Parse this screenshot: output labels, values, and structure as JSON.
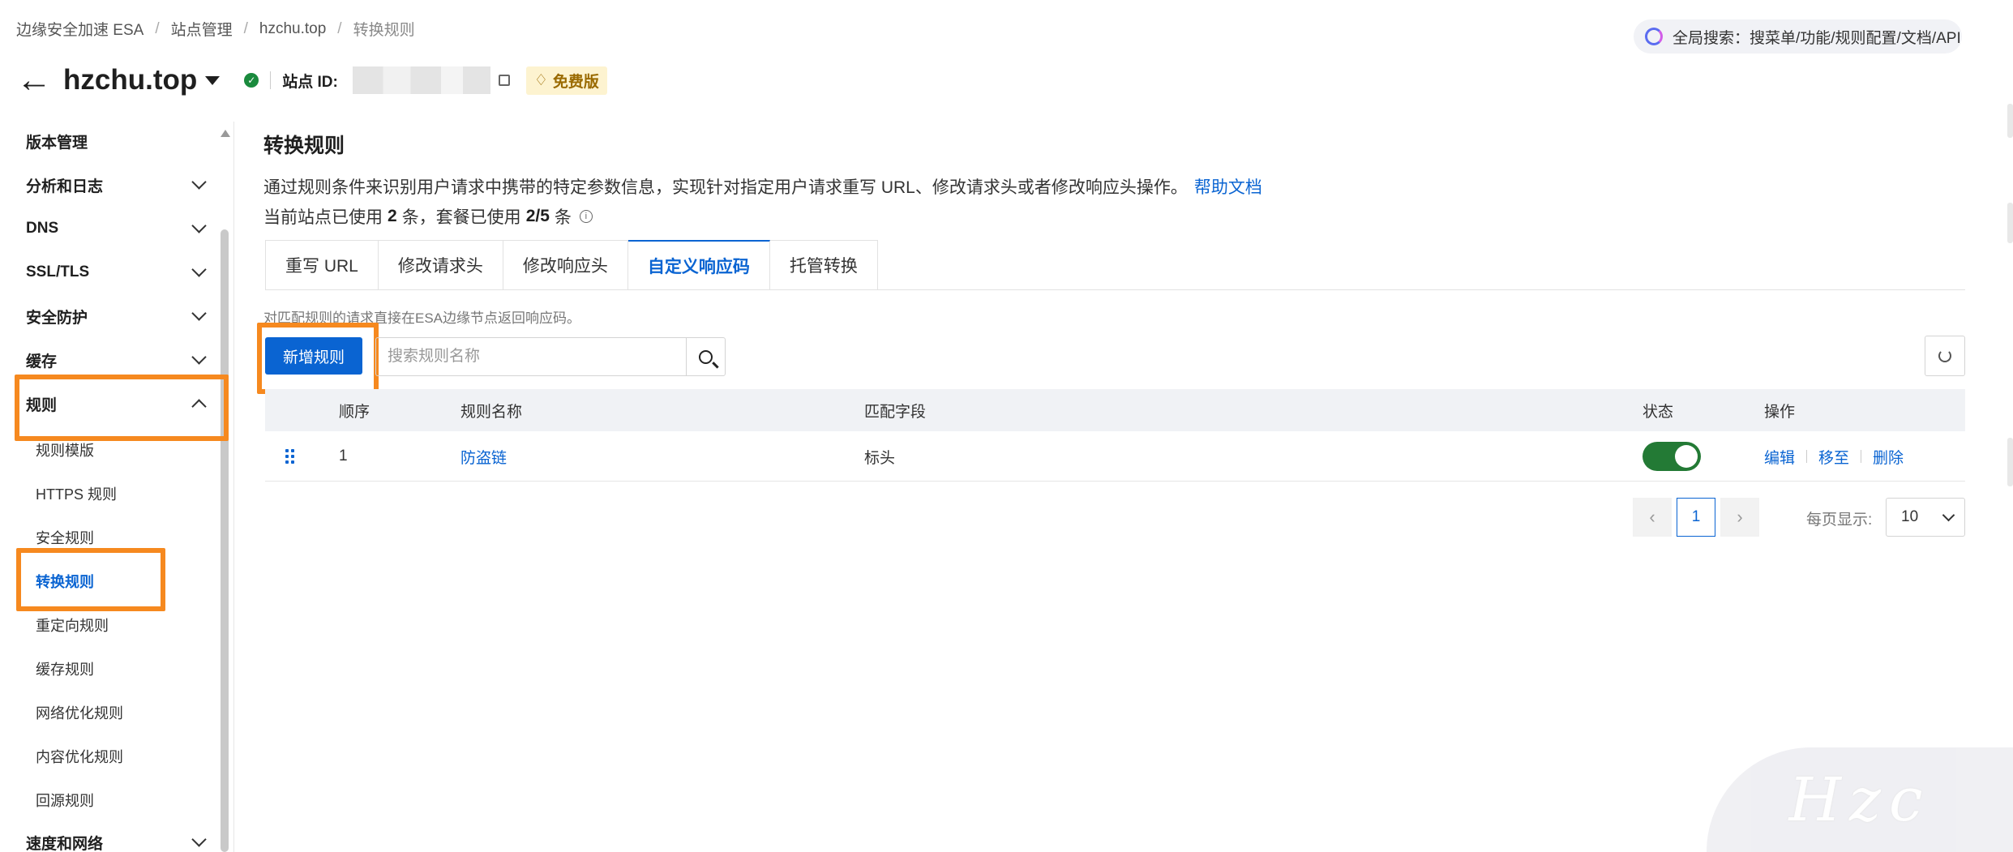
{
  "breadcrumb": [
    "边缘安全加速 ESA",
    "站点管理",
    "hzchu.top",
    "转换规则"
  ],
  "global_search": {
    "label": "全局搜索：搜菜单/功能/规则配置/文档/API"
  },
  "site": {
    "name": "hzchu.top",
    "id_label": "站点 ID:",
    "plan_badge": "免费版"
  },
  "sidebar": {
    "groups": [
      {
        "label": "版本管理",
        "expandable": false
      },
      {
        "label": "分析和日志",
        "expandable": true
      },
      {
        "label": "DNS",
        "expandable": true
      },
      {
        "label": "SSL/TLS",
        "expandable": true
      },
      {
        "label": "安全防护",
        "expandable": true
      },
      {
        "label": "缓存",
        "expandable": true
      },
      {
        "label": "规则",
        "expandable": true,
        "expanded": true
      },
      {
        "label": "速度和网络",
        "expandable": true
      }
    ],
    "rule_items": [
      "规则模版",
      "HTTPS 规则",
      "安全规则",
      "转换规则",
      "重定向规则",
      "缓存规则",
      "网络优化规则",
      "内容优化规则",
      "回源规则"
    ],
    "active_item": "转换规则"
  },
  "main": {
    "title": "转换规则",
    "description": "通过规则条件来识别用户请求中携带的特定参数信息，实现针对指定用户请求重写 URL、修改请求头或者修改响应头操作。",
    "help_link": "帮助文档",
    "usage": {
      "prefix": "当前站点已使用",
      "site_used": "2",
      "mid": "条，套餐已使用",
      "plan_used": "2/5",
      "suffix": "条"
    },
    "tabs": [
      "重写 URL",
      "修改请求头",
      "修改响应头",
      "自定义响应码",
      "托管转换"
    ],
    "active_tab": "自定义响应码",
    "tab_note": "对匹配规则的请求直接在ESA边缘节点返回响应码。",
    "add_button": "新增规则",
    "search_placeholder": "搜索规则名称",
    "table": {
      "columns": [
        "顺序",
        "规则名称",
        "匹配字段",
        "状态",
        "操作"
      ],
      "rows": [
        {
          "order": "1",
          "name": "防盗链",
          "match": "标头",
          "enabled": true,
          "ops": [
            "编辑",
            "移至",
            "删除"
          ]
        }
      ]
    },
    "pagination": {
      "current": "1",
      "per_page_label": "每页显示:",
      "per_page": "10"
    }
  },
  "watermark": "Hzc",
  "colors": {
    "accent": "#0a64d2",
    "highlight": "#f6891f",
    "toggle_on": "#237a35"
  }
}
